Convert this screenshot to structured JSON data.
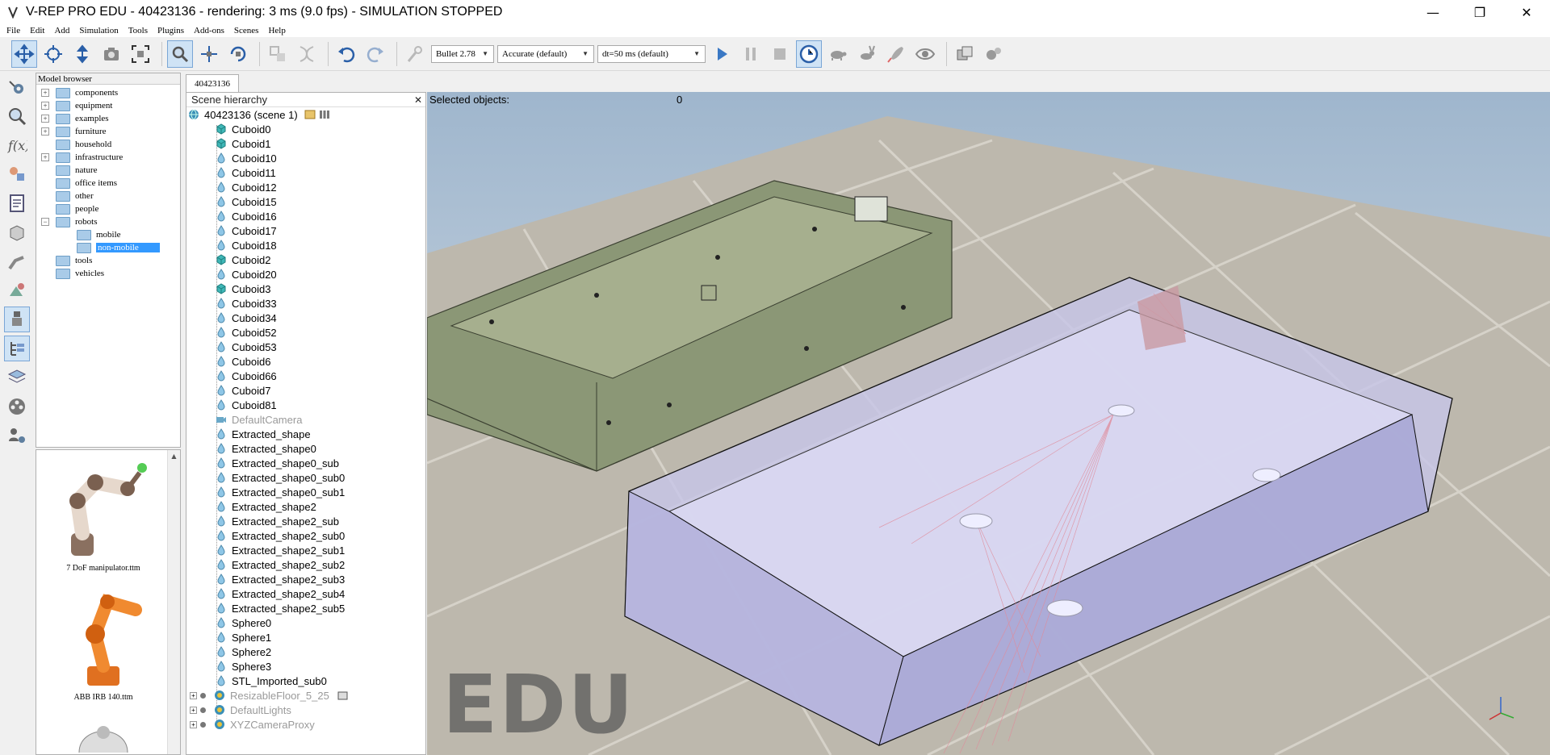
{
  "window": {
    "title": "V-REP PRO EDU - 40423136 - rendering: 3 ms (9.0 fps) - SIMULATION STOPPED",
    "minimize_glyph": "—",
    "maximize_glyph": "❐",
    "close_glyph": "✕"
  },
  "menu": [
    "File",
    "Edit",
    "Add",
    "Simulation",
    "Tools",
    "Plugins",
    "Add-ons",
    "Scenes",
    "Help"
  ],
  "toolbar": {
    "engine": "Bullet 2.78",
    "accuracy": "Accurate (default)",
    "timestep": "dt=50 ms (default)",
    "combo_arrow": "▼"
  },
  "model_browser": {
    "title": "Model browser",
    "items": [
      {
        "label": "components",
        "expander": "+",
        "depth": 0
      },
      {
        "label": "equipment",
        "expander": "+",
        "depth": 0
      },
      {
        "label": "examples",
        "expander": "+",
        "depth": 0
      },
      {
        "label": "furniture",
        "expander": "+",
        "depth": 0
      },
      {
        "label": "household",
        "expander": "",
        "depth": 0
      },
      {
        "label": "infrastructure",
        "expander": "+",
        "depth": 0
      },
      {
        "label": "nature",
        "expander": "",
        "depth": 0
      },
      {
        "label": "office items",
        "expander": "",
        "depth": 0
      },
      {
        "label": "other",
        "expander": "",
        "depth": 0
      },
      {
        "label": "people",
        "expander": "",
        "depth": 0
      },
      {
        "label": "robots",
        "expander": "−",
        "depth": 0
      },
      {
        "label": "mobile",
        "expander": "",
        "depth": 1
      },
      {
        "label": "non-mobile",
        "expander": "",
        "depth": 1,
        "selected": true
      },
      {
        "label": "tools",
        "expander": "",
        "depth": 0
      },
      {
        "label": "vehicles",
        "expander": "",
        "depth": 0
      }
    ],
    "thumbnails": [
      "7 DoF manipulator.ttm",
      "ABB IRB 140.ttm"
    ]
  },
  "document_tab": "40423136",
  "scene_hierarchy": {
    "title": "Scene hierarchy",
    "close_glyph": "✕",
    "root": "40423136 (scene 1)",
    "objects": [
      {
        "name": "Cuboid0",
        "icon": "cuboid-icon"
      },
      {
        "name": "Cuboid1",
        "icon": "cuboid-icon"
      },
      {
        "name": "Cuboid10",
        "icon": "drop-shape-icon"
      },
      {
        "name": "Cuboid11",
        "icon": "drop-shape-icon"
      },
      {
        "name": "Cuboid12",
        "icon": "drop-shape-icon"
      },
      {
        "name": "Cuboid15",
        "icon": "drop-shape-icon"
      },
      {
        "name": "Cuboid16",
        "icon": "drop-shape-icon"
      },
      {
        "name": "Cuboid17",
        "icon": "drop-shape-icon"
      },
      {
        "name": "Cuboid18",
        "icon": "drop-shape-icon"
      },
      {
        "name": "Cuboid2",
        "icon": "cuboid-icon"
      },
      {
        "name": "Cuboid20",
        "icon": "drop-shape-icon"
      },
      {
        "name": "Cuboid3",
        "icon": "cuboid-icon"
      },
      {
        "name": "Cuboid33",
        "icon": "drop-shape-icon"
      },
      {
        "name": "Cuboid34",
        "icon": "drop-shape-icon"
      },
      {
        "name": "Cuboid52",
        "icon": "drop-shape-icon"
      },
      {
        "name": "Cuboid53",
        "icon": "drop-shape-icon"
      },
      {
        "name": "Cuboid6",
        "icon": "drop-shape-icon"
      },
      {
        "name": "Cuboid66",
        "icon": "drop-shape-icon"
      },
      {
        "name": "Cuboid7",
        "icon": "drop-shape-icon"
      },
      {
        "name": "Cuboid81",
        "icon": "drop-shape-icon"
      },
      {
        "name": "DefaultCamera",
        "icon": "camera-icon",
        "dim": true
      },
      {
        "name": "Extracted_shape",
        "icon": "drop-shape-icon"
      },
      {
        "name": "Extracted_shape0",
        "icon": "drop-shape-icon"
      },
      {
        "name": "Extracted_shape0_sub",
        "icon": "drop-shape-icon"
      },
      {
        "name": "Extracted_shape0_sub0",
        "icon": "drop-shape-icon"
      },
      {
        "name": "Extracted_shape0_sub1",
        "icon": "drop-shape-icon"
      },
      {
        "name": "Extracted_shape2",
        "icon": "drop-shape-icon"
      },
      {
        "name": "Extracted_shape2_sub",
        "icon": "drop-shape-icon"
      },
      {
        "name": "Extracted_shape2_sub0",
        "icon": "drop-shape-icon"
      },
      {
        "name": "Extracted_shape2_sub1",
        "icon": "drop-shape-icon"
      },
      {
        "name": "Extracted_shape2_sub2",
        "icon": "drop-shape-icon"
      },
      {
        "name": "Extracted_shape2_sub3",
        "icon": "drop-shape-icon"
      },
      {
        "name": "Extracted_shape2_sub4",
        "icon": "drop-shape-icon"
      },
      {
        "name": "Extracted_shape2_sub5",
        "icon": "drop-shape-icon"
      },
      {
        "name": "Sphere0",
        "icon": "drop-shape-icon"
      },
      {
        "name": "Sphere1",
        "icon": "drop-shape-icon"
      },
      {
        "name": "Sphere2",
        "icon": "drop-shape-icon"
      },
      {
        "name": "Sphere3",
        "icon": "drop-shape-icon"
      },
      {
        "name": "STL_Imported_sub0",
        "icon": "drop-shape-icon"
      }
    ],
    "models": [
      {
        "name": "ResizableFloor_5_25",
        "icon": "model-icon",
        "dim": true
      },
      {
        "name": "DefaultLights",
        "icon": "model-icon",
        "dim": true
      },
      {
        "name": "XYZCameraProxy",
        "icon": "model-icon",
        "dim": true
      }
    ]
  },
  "viewport": {
    "selected_label": "Selected objects:",
    "selected_count": "0",
    "watermark": "EDU"
  }
}
